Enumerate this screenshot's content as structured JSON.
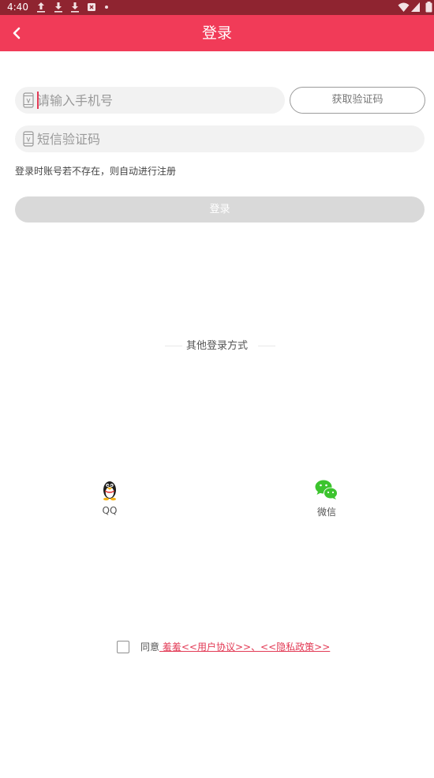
{
  "status_bar": {
    "time": "4:40",
    "left_icons": [
      "upload-icon",
      "download-icon",
      "download-icon",
      "app-notification-icon",
      "dot-icon"
    ],
    "right_icons": [
      "wifi-icon",
      "signal-icon",
      "battery-icon"
    ]
  },
  "header": {
    "title": "登录",
    "back_icon": "chevron-left-icon",
    "background_color": "#f13b58"
  },
  "form": {
    "phone_placeholder": "请输入手机号",
    "phone_value": "",
    "get_code_label": "获取验证码",
    "code_placeholder": "短信验证码",
    "code_value": "",
    "hint": "登录时账号若不存在，则自动进行注册",
    "login_label": "登录",
    "login_button_color": "#d9d9d9"
  },
  "other_login": {
    "title": "其他登录方式",
    "options": [
      {
        "label": "QQ",
        "icon": "qq-penguin-icon"
      },
      {
        "label": "微信",
        "icon": "wechat-icon"
      }
    ]
  },
  "agreement": {
    "checked": false,
    "prefix": "同意",
    "links_text": " 羞羞<<用户协议>>、<<隐私政策>>",
    "link_color": "#e23a55"
  }
}
